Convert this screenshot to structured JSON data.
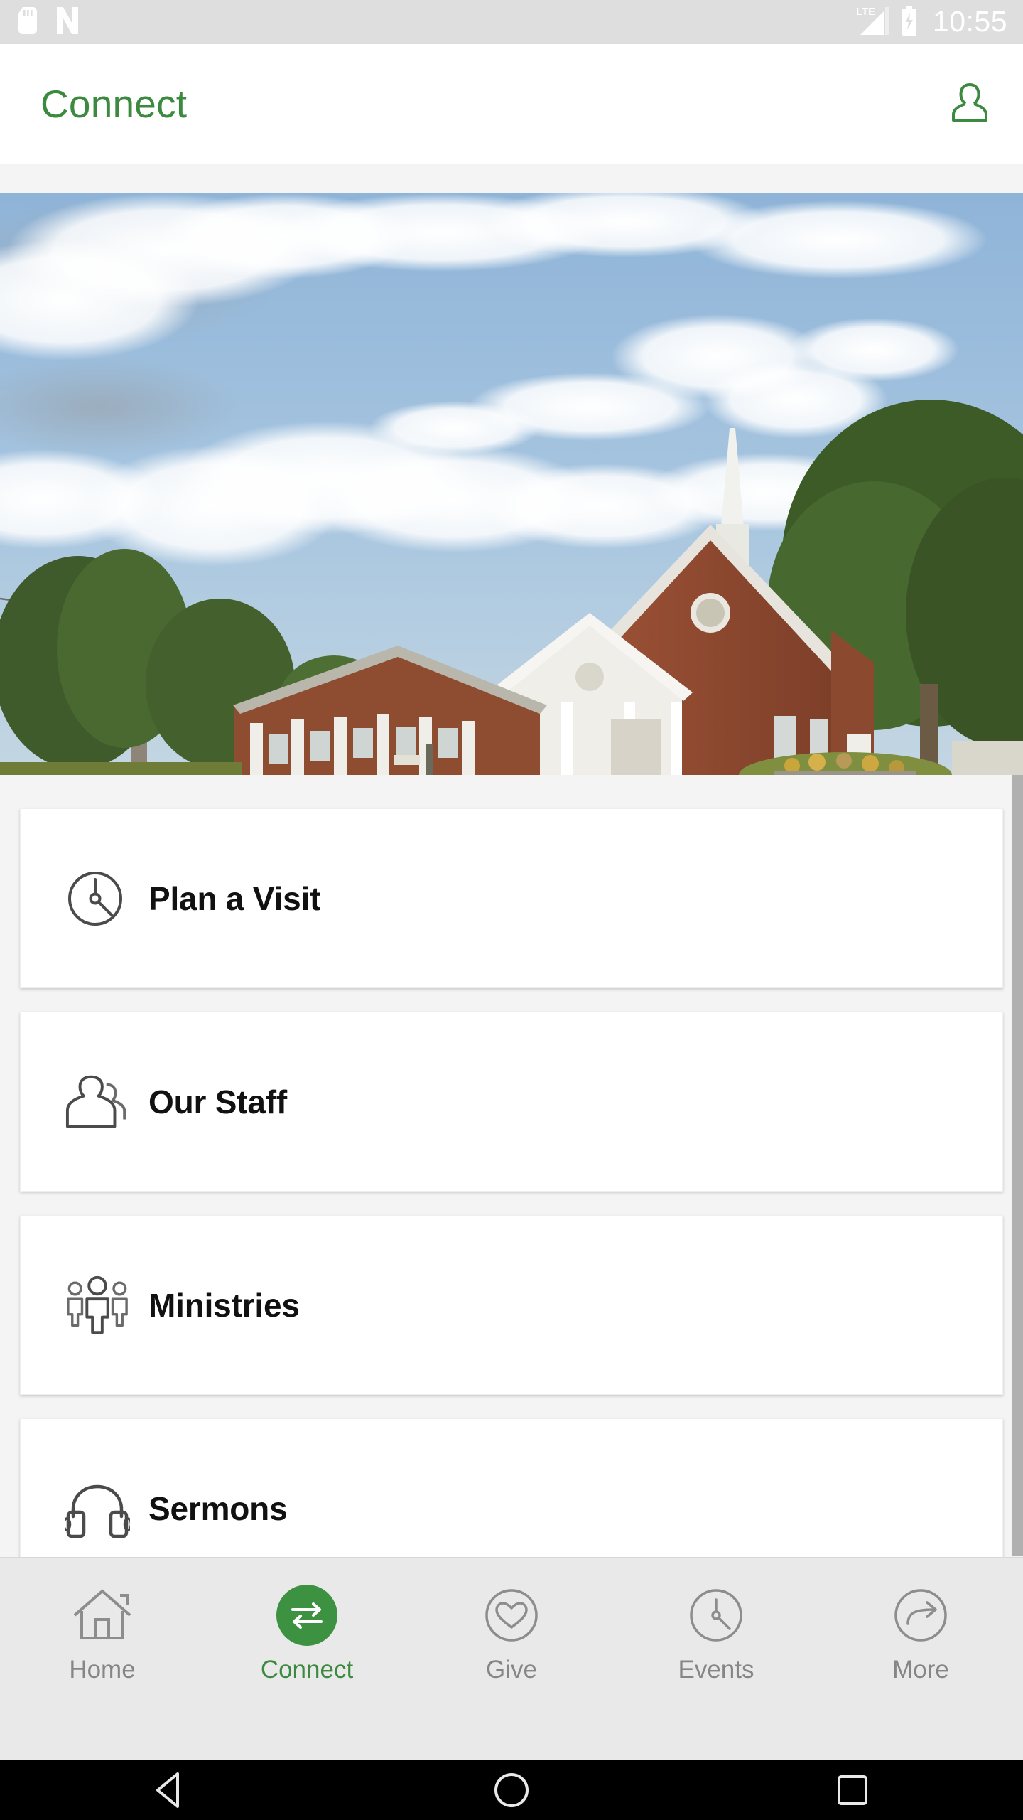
{
  "status_bar": {
    "time": "10:55",
    "icons": [
      "sd-card-icon",
      "nfc-n-icon",
      "lte-signal-icon",
      "battery-charging-icon"
    ],
    "network_label": "LTE",
    "background": "#dededf"
  },
  "app_bar": {
    "title": "Connect",
    "title_color": "#3c8a3f",
    "profile_icon": "profile-person-icon"
  },
  "hero": {
    "alt": "Brick church building with white steeple, trees and lawn under a cloudy blue sky"
  },
  "list": {
    "items": [
      {
        "label": "Plan a Visit",
        "icon": "clock-icon"
      },
      {
        "label": "Our Staff",
        "icon": "two-people-icon"
      },
      {
        "label": "Ministries",
        "icon": "three-people-group-icon"
      },
      {
        "label": "Sermons",
        "icon": "headphones-icon"
      }
    ]
  },
  "tab_bar": {
    "active_color": "#3c9240",
    "inactive_color": "#868686",
    "tabs": [
      {
        "label": "Home",
        "icon": "house-icon",
        "active": false
      },
      {
        "label": "Connect",
        "icon": "exchange-arrows-icon",
        "active": true
      },
      {
        "label": "Give",
        "icon": "heart-circle-icon",
        "active": false
      },
      {
        "label": "Events",
        "icon": "clock-circle-icon",
        "active": false
      },
      {
        "label": "More",
        "icon": "arrow-right-circle-icon",
        "active": false
      }
    ]
  },
  "system_nav": {
    "buttons": [
      "back-triangle-icon",
      "home-circle-icon",
      "recents-square-icon"
    ]
  }
}
